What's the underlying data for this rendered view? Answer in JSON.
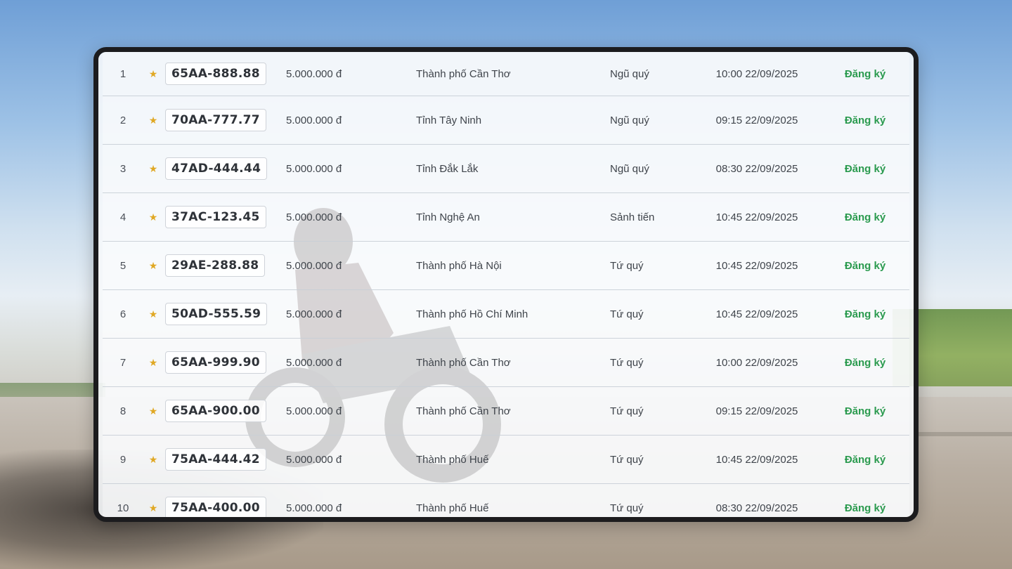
{
  "rows": [
    {
      "index": "1",
      "plate": "65AA-888.88",
      "price": "5.000.000 đ",
      "province": "Thành phố Cần Thơ",
      "type": "Ngũ quý",
      "time": "10:00 22/09/2025",
      "action": "Đăng ký"
    },
    {
      "index": "2",
      "plate": "70AA-777.77",
      "price": "5.000.000 đ",
      "province": "Tỉnh Tây Ninh",
      "type": "Ngũ quý",
      "time": "09:15 22/09/2025",
      "action": "Đăng ký"
    },
    {
      "index": "3",
      "plate": "47AD-444.44",
      "price": "5.000.000 đ",
      "province": "Tỉnh Đắk Lắk",
      "type": "Ngũ quý",
      "time": "08:30 22/09/2025",
      "action": "Đăng ký"
    },
    {
      "index": "4",
      "plate": "37AC-123.45",
      "price": "5.000.000 đ",
      "province": "Tỉnh Nghệ An",
      "type": "Sảnh tiến",
      "time": "10:45 22/09/2025",
      "action": "Đăng ký"
    },
    {
      "index": "5",
      "plate": "29AE-288.88",
      "price": "5.000.000 đ",
      "province": "Thành phố Hà Nội",
      "type": "Tứ quý",
      "time": "10:45 22/09/2025",
      "action": "Đăng ký"
    },
    {
      "index": "6",
      "plate": "50AD-555.59",
      "price": "5.000.000 đ",
      "province": "Thành phố Hồ Chí Minh",
      "type": "Tứ quý",
      "time": "10:45 22/09/2025",
      "action": "Đăng ký"
    },
    {
      "index": "7",
      "plate": "65AA-999.90",
      "price": "5.000.000 đ",
      "province": "Thành phố Cần Thơ",
      "type": "Tứ quý",
      "time": "10:00 22/09/2025",
      "action": "Đăng ký"
    },
    {
      "index": "8",
      "plate": "65AA-900.00",
      "price": "5.000.000 đ",
      "province": "Thành phố Cần Thơ",
      "type": "Tứ quý",
      "time": "09:15 22/09/2025",
      "action": "Đăng ký"
    },
    {
      "index": "9",
      "plate": "75AA-444.42",
      "price": "5.000.000 đ",
      "province": "Thành phố Huế",
      "type": "Tứ quý",
      "time": "10:45 22/09/2025",
      "action": "Đăng ký"
    },
    {
      "index": "10",
      "plate": "75AA-400.00",
      "price": "5.000.000 đ",
      "province": "Thành phố Huế",
      "type": "Tứ quý",
      "time": "08:30 22/09/2025",
      "action": "Đăng ký"
    }
  ],
  "icons": {
    "star": "star-icon"
  },
  "colors": {
    "action": "#2a9a4e",
    "star": "#e0a824"
  }
}
